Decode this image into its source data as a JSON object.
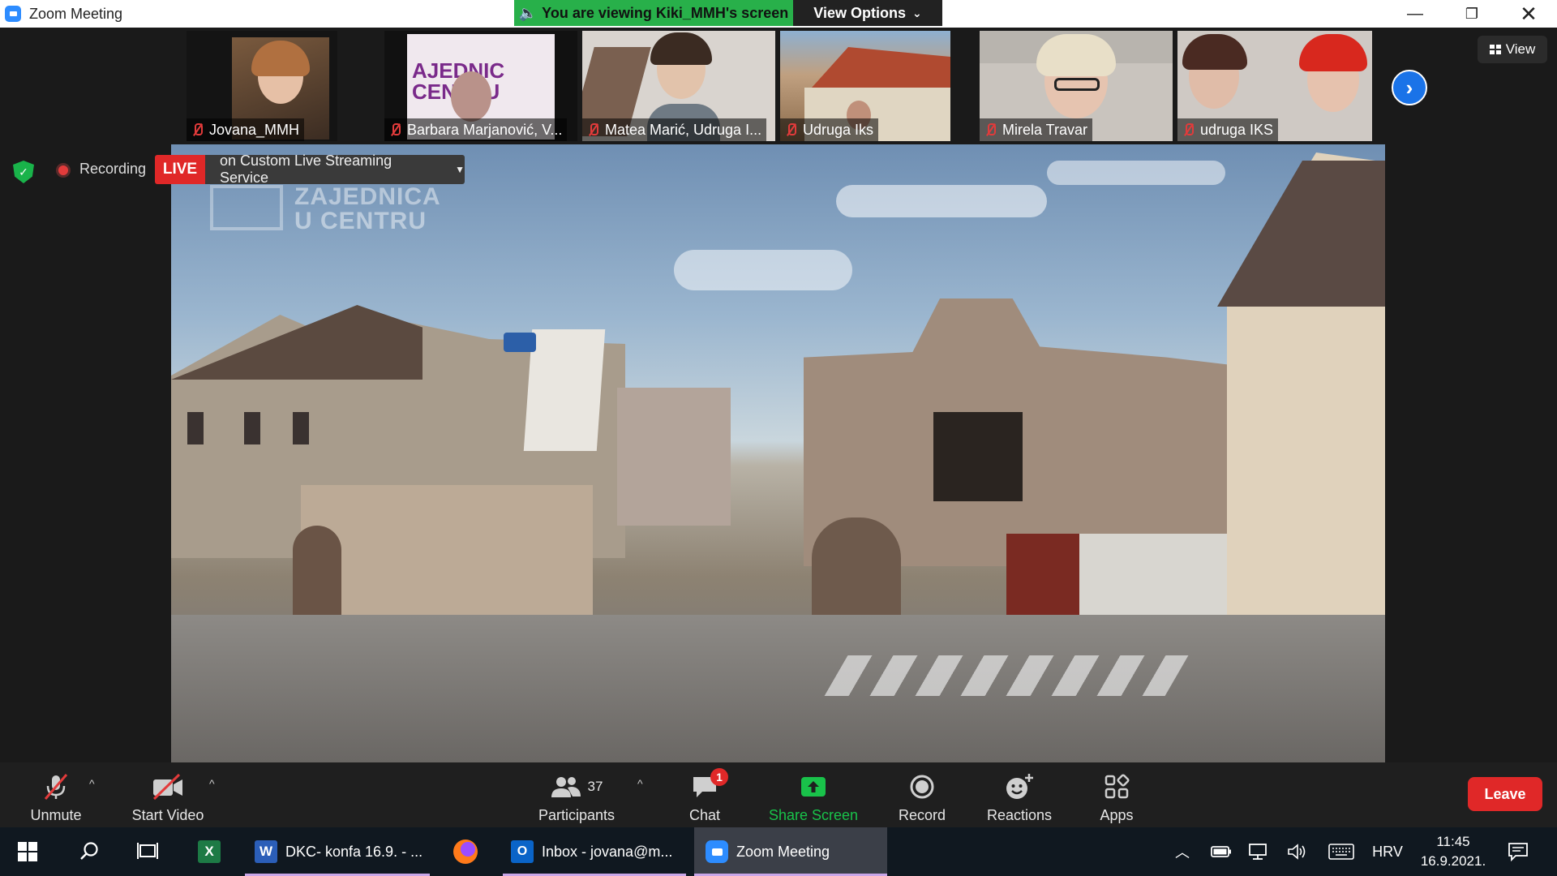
{
  "window": {
    "title": "Zoom Meeting",
    "viewing_banner": "You are viewing Kiki_MMH's screen",
    "view_options": "View Options"
  },
  "participants_strip": [
    {
      "name": "Jovana_MMH",
      "bg": "#6a5a48"
    },
    {
      "name": "Barbara Marjanović, V...",
      "bg": "#e8e2ea"
    },
    {
      "name": "Matea Marić, Udruga I...",
      "bg": "#d9d4cf"
    },
    {
      "name": "Udruga Iks",
      "bg": "#9a7a5a"
    },
    {
      "name": "Mirela Travar",
      "bg": "#c9c4be"
    },
    {
      "name": "udruga IKS",
      "bg": "#cfc9c4"
    }
  ],
  "view_button": "View",
  "status": {
    "recording": "Recording",
    "live": "LIVE",
    "live_service": "on Custom Live Streaming Service"
  },
  "shared_screen": {
    "watermark_line1": "ZAJEDNICA",
    "watermark_line2": "U CENTRU"
  },
  "toolbar": {
    "unmute": "Unmute",
    "start_video": "Start Video",
    "participants": "Participants",
    "participants_count": "37",
    "chat": "Chat",
    "chat_badge": "1",
    "share_screen": "Share Screen",
    "record": "Record",
    "reactions": "Reactions",
    "apps": "Apps",
    "leave": "Leave"
  },
  "taskbar": {
    "word": "DKC- konfa 16.9. - ...",
    "outlook": "Inbox - jovana@m...",
    "zoom": "Zoom Meeting",
    "language": "HRV",
    "time": "11:45",
    "date": "16.9.2021."
  },
  "colors": {
    "accent_blue": "#2d8cff",
    "banner_green": "#28b04a",
    "live_red": "#e02828",
    "share_green": "#19c24a"
  }
}
